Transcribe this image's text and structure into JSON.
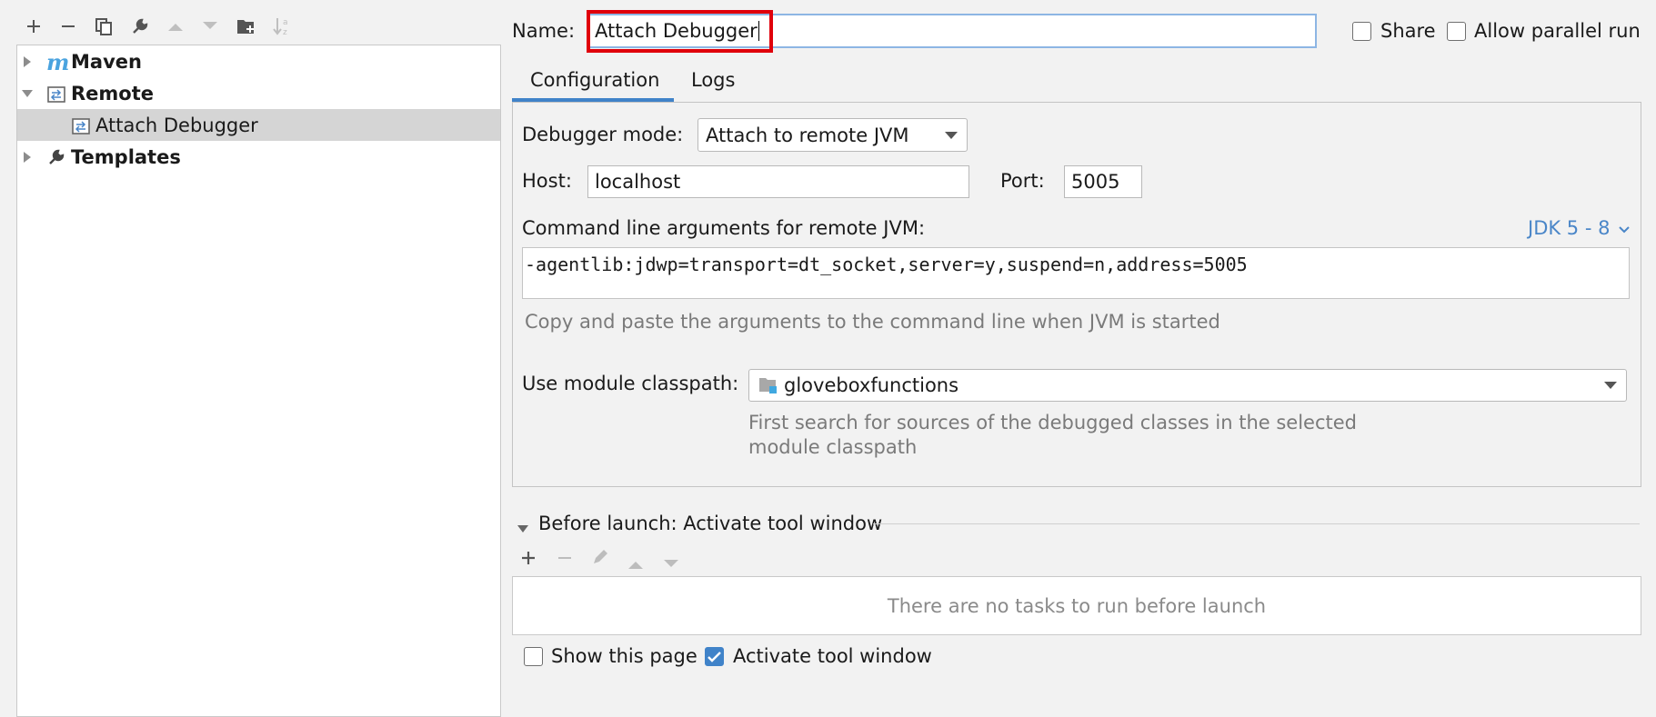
{
  "toolbar": {
    "buttons": [
      "add-icon",
      "remove-icon",
      "copy-icon",
      "wrench-icon",
      "move-up-icon",
      "move-down-icon",
      "new-folder-icon",
      "sort-icon"
    ]
  },
  "tree": {
    "items": [
      {
        "label": "Maven",
        "icon": "maven-icon"
      },
      {
        "label": "Remote",
        "icon": "remote-icon"
      },
      {
        "label": "Attach Debugger",
        "icon": "remote-config-icon"
      },
      {
        "label": "Templates",
        "icon": "wrench-icon"
      }
    ]
  },
  "header": {
    "name_label": "Name:",
    "name_value": "Attach Debugger",
    "share_label": "Share",
    "allow_parallel_label": "Allow parallel run",
    "share_checked": false,
    "allow_parallel_checked": false
  },
  "tabs": [
    {
      "label": "Configuration",
      "active": true
    },
    {
      "label": "Logs",
      "active": false
    }
  ],
  "config": {
    "debugger_mode_label": "Debugger mode:",
    "debugger_mode_value": "Attach to remote JVM",
    "host_label": "Host:",
    "host_value": "localhost",
    "port_label": "Port:",
    "port_value": "5005",
    "cmd_label": "Command line arguments for remote JVM:",
    "jdk_link": "JDK 5 - 8",
    "cmd_value": "-agentlib:jdwp=transport=dt_socket,server=y,suspend=n,address=5005",
    "cmd_hint": "Copy and paste the arguments to the command line when JVM is started",
    "module_label": "Use module classpath:",
    "module_value": "gloveboxfunctions",
    "module_hint_line1": "First search for sources of the debugged classes in the selected",
    "module_hint_line2": "module classpath"
  },
  "before_launch": {
    "title": "Before launch: Activate tool window",
    "empty_text": "There are no tasks to run before launch",
    "tools": [
      "add-icon",
      "remove-icon",
      "edit-icon",
      "move-up-icon",
      "move-down-icon"
    ]
  },
  "footer": {
    "show_page_label": "Show this page",
    "show_page_checked": false,
    "activate_label": "Activate tool window",
    "activate_checked": true
  },
  "colors": {
    "accent": "#4083c9",
    "highlight_box": "#e0000b",
    "selection": "#d5d5d5"
  }
}
